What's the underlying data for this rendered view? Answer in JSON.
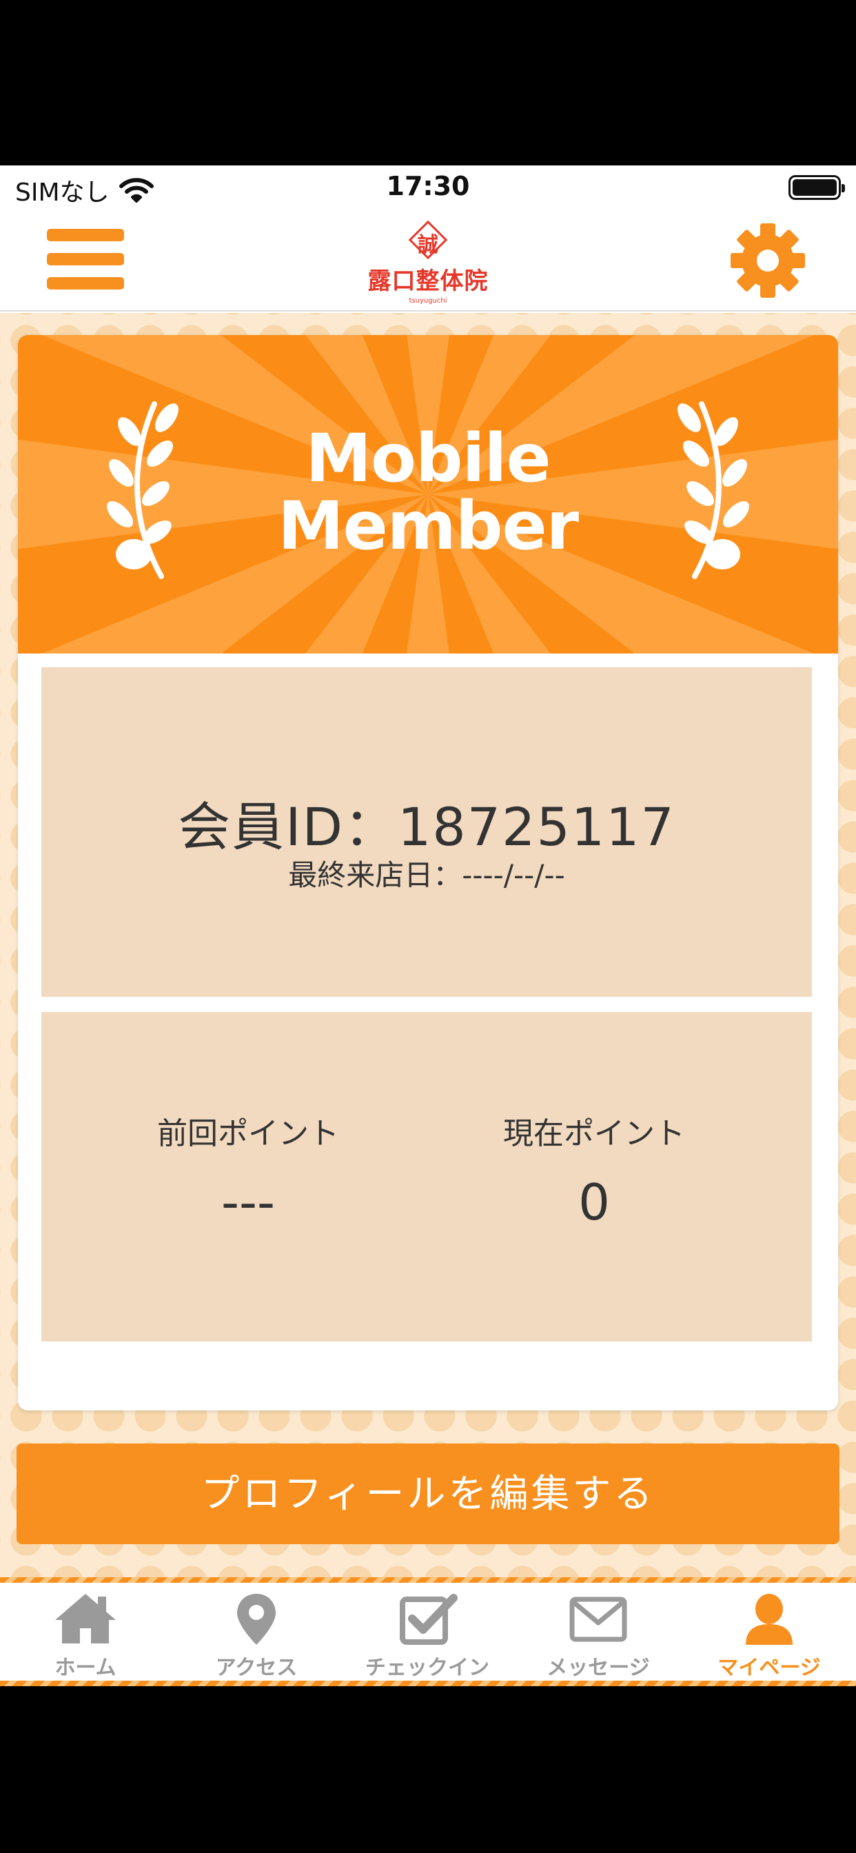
{
  "status_bar": {
    "carrier": "SIMなし",
    "time": "17:30"
  },
  "header": {
    "logo": {
      "mark": "誠",
      "name": "露口整体院",
      "sub": "tsuyuguchi"
    },
    "accent_color": "#f7901e"
  },
  "banner": {
    "title_line1": "Mobile",
    "title_line2": "Member"
  },
  "member": {
    "id_text": "会員ID：18725117",
    "last_visit_text": "最終来店日：----/--/--"
  },
  "points": {
    "previous_label": "前回ポイント",
    "previous_value": "---",
    "current_label": "現在ポイント",
    "current_value": "0"
  },
  "edit_profile_label": "プロフィールを編集する",
  "tabs": [
    {
      "label": "ホーム",
      "icon": "home-icon"
    },
    {
      "label": "アクセス",
      "icon": "map-pin-icon"
    },
    {
      "label": "チェックイン",
      "icon": "checkbox-icon"
    },
    {
      "label": "メッセージ",
      "icon": "envelope-icon"
    },
    {
      "label": "マイページ",
      "icon": "person-icon",
      "active": true
    }
  ]
}
